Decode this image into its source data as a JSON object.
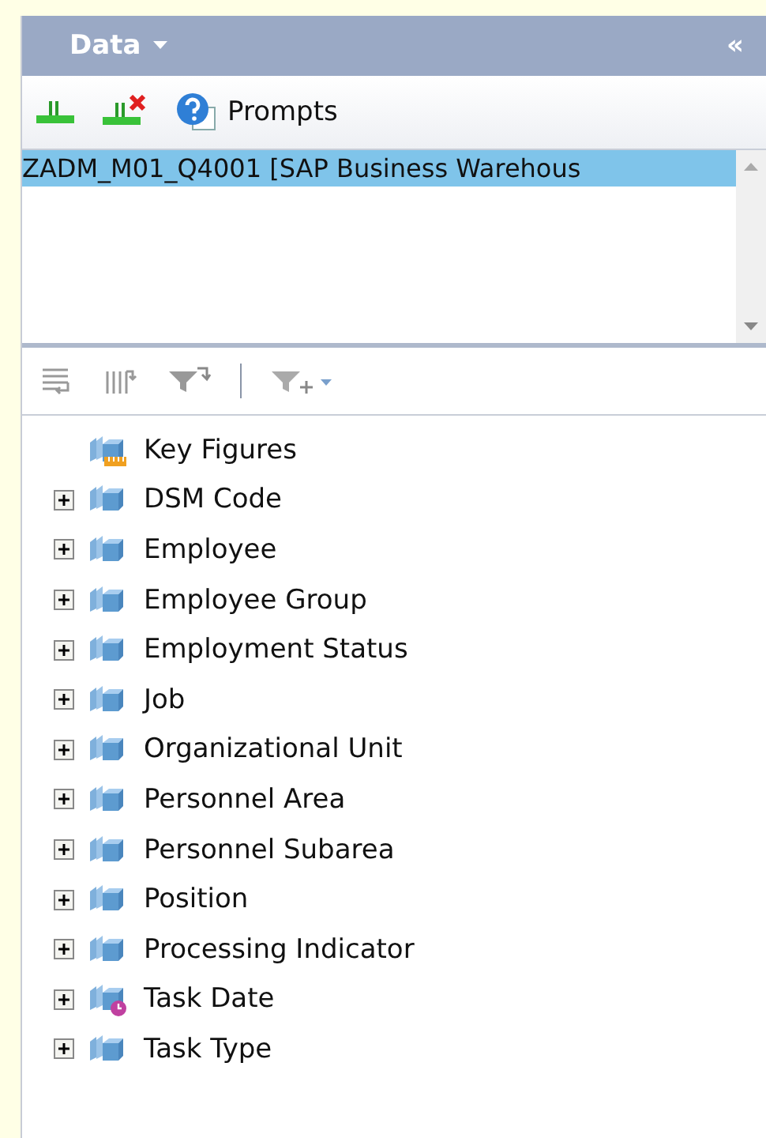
{
  "panel": {
    "title": "Data",
    "collapse": "«"
  },
  "toolbar": {
    "prompts_label": "Prompts"
  },
  "queries": [
    {
      "name": "ZADM_M01_Q4001 [SAP Business Warehous",
      "selected": true
    }
  ],
  "tree": [
    {
      "kind": "key_figures",
      "label": "Key Figures"
    },
    {
      "kind": "dimension",
      "label": "DSM Code",
      "expanded": false
    },
    {
      "kind": "dimension",
      "label": "Employee",
      "expanded": false
    },
    {
      "kind": "dimension",
      "label": "Employee Group",
      "expanded": false
    },
    {
      "kind": "dimension",
      "label": "Employment Status",
      "expanded": false
    },
    {
      "kind": "dimension",
      "label": "Job",
      "expanded": false
    },
    {
      "kind": "dimension",
      "label": "Organizational Unit",
      "expanded": false
    },
    {
      "kind": "dimension",
      "label": "Personnel Area",
      "expanded": false
    },
    {
      "kind": "dimension",
      "label": "Personnel Subarea",
      "expanded": false
    },
    {
      "kind": "dimension",
      "label": "Position",
      "expanded": false
    },
    {
      "kind": "dimension",
      "label": "Processing Indicator",
      "expanded": false
    },
    {
      "kind": "time_dimension",
      "label": "Task Date",
      "expanded": false
    },
    {
      "kind": "dimension",
      "label": "Task Type",
      "expanded": false
    }
  ]
}
